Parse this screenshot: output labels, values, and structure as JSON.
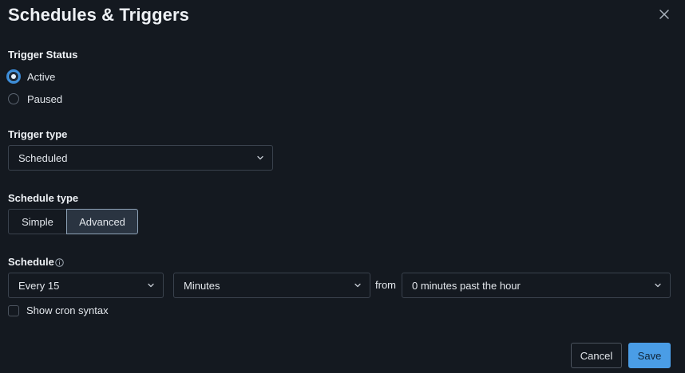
{
  "dialog": {
    "title": "Schedules & Triggers"
  },
  "trigger_status": {
    "label": "Trigger Status",
    "options": [
      {
        "label": "Active",
        "selected": true
      },
      {
        "label": "Paused",
        "selected": false
      }
    ]
  },
  "trigger_type": {
    "label": "Trigger type",
    "value": "Scheduled"
  },
  "schedule_type": {
    "label": "Schedule type",
    "options": [
      {
        "label": "Simple",
        "selected": false
      },
      {
        "label": "Advanced",
        "selected": true
      }
    ]
  },
  "schedule": {
    "label": "Schedule",
    "interval": "Every 15",
    "unit": "Minutes",
    "from_label": "from",
    "offset": "0 minutes past the hour",
    "show_cron_label": "Show cron syntax",
    "show_cron_checked": false
  },
  "footer": {
    "cancel_label": "Cancel",
    "save_label": "Save"
  },
  "colors": {
    "background": "#141920",
    "accent": "#4a9de6",
    "border": "#3a424d"
  }
}
